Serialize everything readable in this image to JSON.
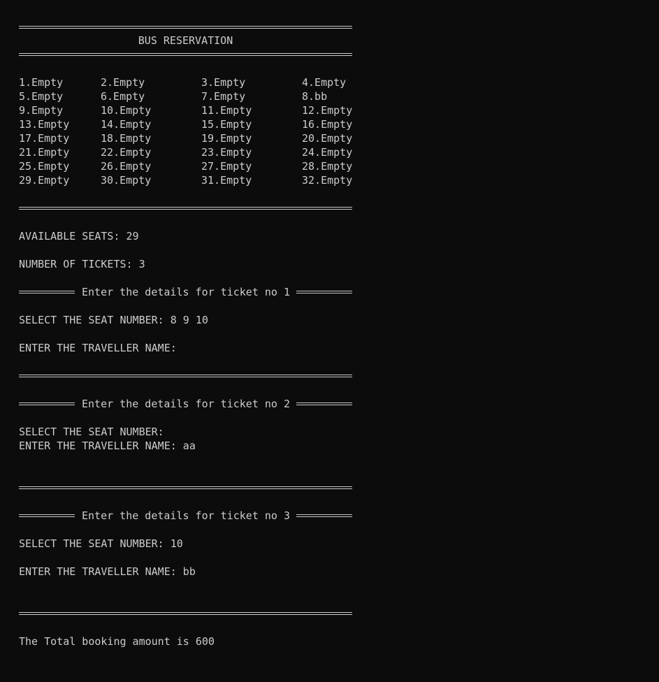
{
  "header": {
    "title": "BUS RESERVATION"
  },
  "seats": [
    "1.Empty",
    "2.Empty",
    "3.Empty",
    "4.Empty",
    "5.Empty",
    "6.Empty",
    "7.Empty",
    "8.bb",
    "9.Empty",
    "10.Empty",
    "11.Empty",
    "12.Empty",
    "13.Empty",
    "14.Empty",
    "15.Empty",
    "16.Empty",
    "17.Empty",
    "18.Empty",
    "19.Empty",
    "20.Empty",
    "21.Empty",
    "22.Empty",
    "23.Empty",
    "24.Empty",
    "25.Empty",
    "26.Empty",
    "27.Empty",
    "28.Empty",
    "29.Empty",
    "30.Empty",
    "31.Empty",
    "32.Empty"
  ],
  "summary": {
    "available": "AVAILABLE SEATS: 29",
    "tickets": "NUMBER OF TICKETS: 3"
  },
  "tickets": [
    {
      "header": "Enter the details for ticket no 1",
      "seat_line": "SELECT THE SEAT NUMBER: 8 9 10",
      "name_line": "ENTER THE TRAVELLER NAME:"
    },
    {
      "header": "Enter the details for ticket no 2",
      "seat_line": "SELECT THE SEAT NUMBER:",
      "name_line": "ENTER THE TRAVELLER NAME: aa"
    },
    {
      "header": "Enter the details for ticket no 3",
      "seat_line": "SELECT THE SEAT NUMBER: 10",
      "name_line": "ENTER THE TRAVELLER NAME: bb"
    }
  ],
  "total": "The Total booking amount is 600",
  "colors": {
    "background": "#0c0c0c",
    "text": "#cccccc"
  }
}
